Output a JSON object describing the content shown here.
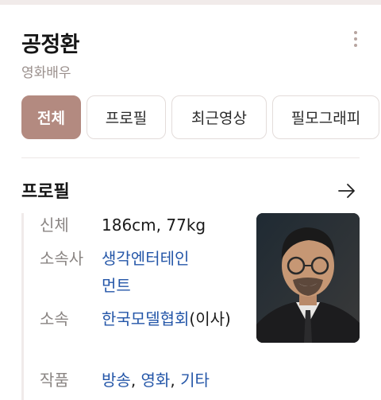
{
  "header": {
    "name": "공정환",
    "occupation": "영화배우"
  },
  "tabs": [
    {
      "label": "전체",
      "active": true
    },
    {
      "label": "프로필",
      "active": false
    },
    {
      "label": "최근영상",
      "active": false
    },
    {
      "label": "필모그래피",
      "active": false
    }
  ],
  "profile": {
    "title": "프로필",
    "rows": [
      {
        "key": "신체",
        "value": "186cm, 77kg"
      },
      {
        "key": "소속사",
        "value": "생각엔터테인먼트"
      },
      {
        "key": "소속",
        "value_link": "한국모델협회",
        "value_suffix": "(이사)"
      },
      {
        "key": "작품",
        "links": [
          "방송",
          "영화",
          "기타"
        ],
        "separator": ", "
      }
    ]
  },
  "colors": {
    "accent": "#b38a80",
    "link": "#2456a8"
  },
  "icons": {
    "more": "more-vertical-icon",
    "arrow": "arrow-right-icon"
  }
}
